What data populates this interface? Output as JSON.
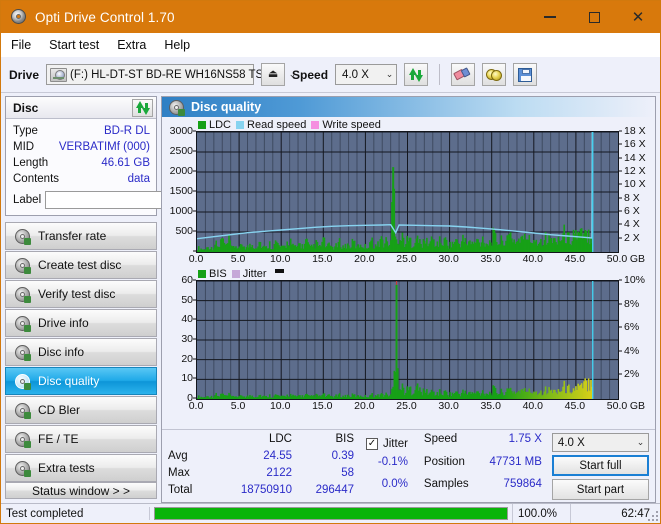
{
  "window": {
    "title": "Opti Drive Control 1.70",
    "icon": "disc-icon",
    "minimize": "—",
    "maximize": "□",
    "close": "✕"
  },
  "menu": {
    "items": [
      "File",
      "Start test",
      "Extra",
      "Help"
    ]
  },
  "toolbar": {
    "drive_label": "Drive",
    "drive_value": "(F:)  HL-DT-ST BD-RE  WH16NS58 TST4",
    "eject_label": "⏏",
    "speed_label": "Speed",
    "speed_value": "4.0 X",
    "chevron": "⌄",
    "icons": [
      "refresh-icon",
      "eraser-icon",
      "two-discs-icon",
      "save-icon"
    ]
  },
  "disc": {
    "header": "Disc",
    "rows": [
      {
        "key": "Type",
        "value": "BD-R DL"
      },
      {
        "key": "MID",
        "value": "VERBATIMf (000)"
      },
      {
        "key": "Length",
        "value": "46.61 GB"
      },
      {
        "key": "Contents",
        "value": "data"
      }
    ],
    "label_key": "Label",
    "label_value": "",
    "label_placeholder": ""
  },
  "sidebar": {
    "items": [
      {
        "label": "Transfer rate",
        "active": false
      },
      {
        "label": "Create test disc",
        "active": false
      },
      {
        "label": "Verify test disc",
        "active": false
      },
      {
        "label": "Drive info",
        "active": false
      },
      {
        "label": "Disc info",
        "active": false
      },
      {
        "label": "Disc quality",
        "active": true
      },
      {
        "label": "CD Bler",
        "active": false
      },
      {
        "label": "FE / TE",
        "active": false
      },
      {
        "label": "Extra tests",
        "active": false
      }
    ],
    "status_window": "Status window > >"
  },
  "panel": {
    "title": "Disc quality",
    "icon": "disc-quality-icon"
  },
  "chart_data": [
    {
      "type": "area",
      "title": "LDC / Read speed",
      "legend": [
        {
          "label": "LDC",
          "color": "#17a017"
        },
        {
          "label": "Read speed",
          "color": "#87d3f0"
        },
        {
          "label": "Write speed",
          "color": "#f58fe0"
        }
      ],
      "legend_position": "top-left",
      "grid": true,
      "xlabel": "GB",
      "xlim": [
        0,
        50
      ],
      "xticks": [
        0.0,
        5.0,
        10.0,
        15.0,
        20.0,
        25.0,
        30.0,
        35.0,
        40.0,
        45.0,
        50.0
      ],
      "xticklabels": [
        "0.0",
        "5.0",
        "10.0",
        "15.0",
        "20.0",
        "25.0",
        "30.0",
        "35.0",
        "40.0",
        "45.0",
        "50.0"
      ],
      "ylabel": "",
      "ylim": [
        0,
        3000
      ],
      "yticks": [
        0,
        500,
        1000,
        1500,
        2000,
        2500,
        3000
      ],
      "yticklabels": [
        "0",
        "500",
        "1000",
        "1500",
        "2000",
        "2500",
        "3000"
      ],
      "y2label": "",
      "y2lim": [
        0,
        18
      ],
      "y2ticks": [
        2,
        4,
        6,
        8,
        10,
        12,
        14,
        16,
        18
      ],
      "y2ticklabels": [
        "2 X",
        "4 X",
        "6 X",
        "8 X",
        "10 X",
        "12 X",
        "14 X",
        "16 X",
        "18 X"
      ],
      "series": [
        {
          "name": "LDC",
          "color": "#17a017",
          "axis": "left",
          "x": [
            0.2,
            0.6,
            1.0,
            1.4,
            1.8,
            2.2,
            2.6,
            3.0,
            3.4,
            3.8,
            4.2,
            4.6,
            5.0,
            5.4,
            5.8,
            6.2,
            6.6,
            7.0,
            7.4,
            7.8,
            8.2,
            8.6,
            9.0,
            9.4,
            9.8,
            10.2,
            10.6,
            11.0,
            11.4,
            11.8,
            12.2,
            12.6,
            13.0,
            13.4,
            13.8,
            14.2,
            14.6,
            15.0,
            15.4,
            15.8,
            16.2,
            16.6,
            17.0,
            17.4,
            17.8,
            18.2,
            18.6,
            19.0,
            19.4,
            19.8,
            20.2,
            20.6,
            21.0,
            21.4,
            21.8,
            22.2,
            22.6,
            23.0,
            23.3,
            23.7,
            24.0,
            24.4,
            24.8,
            25.2,
            25.6,
            26.0,
            26.4,
            26.8,
            27.2,
            27.6,
            28.0,
            28.4,
            28.8,
            29.2,
            29.6,
            30.0,
            30.4,
            30.8,
            31.2,
            31.6,
            32.0,
            32.4,
            32.8,
            33.2,
            33.6,
            34.0,
            34.4,
            34.8,
            35.2,
            35.6,
            36.0,
            36.4,
            36.8,
            37.2,
            37.6,
            38.0,
            38.4,
            38.8,
            39.2,
            39.6,
            40.0,
            40.4,
            40.8,
            41.2,
            41.6,
            42.0,
            42.4,
            42.8,
            43.2,
            43.6,
            44.0,
            44.4,
            44.8,
            45.2,
            45.6,
            46.0,
            46.4,
            46.8
          ],
          "y": [
            120,
            90,
            70,
            180,
            95,
            260,
            120,
            420,
            150,
            330,
            110,
            200,
            90,
            250,
            130,
            180,
            210,
            140,
            330,
            160,
            120,
            250,
            140,
            300,
            160,
            120,
            210,
            390,
            170,
            130,
            260,
            150,
            340,
            120,
            170,
            250,
            140,
            360,
            150,
            200,
            130,
            180,
            290,
            140,
            220,
            160,
            310,
            130,
            240,
            180,
            140,
            380,
            220,
            160,
            420,
            250,
            330,
            180,
            2122,
            520,
            330,
            430,
            290,
            360,
            250,
            400,
            300,
            230,
            340,
            260,
            390,
            220,
            310,
            270,
            350,
            200,
            280,
            320,
            240,
            380,
            260,
            300,
            220,
            340,
            280,
            420,
            250,
            300,
            480,
            360,
            260,
            440,
            300,
            540,
            380,
            290,
            460,
            330,
            520,
            280,
            430,
            360,
            300,
            500,
            340,
            420,
            310,
            470,
            360,
            550,
            420,
            380,
            620,
            480,
            520,
            420,
            600,
            480
          ]
        },
        {
          "name": "Read speed",
          "color": "#87d3f0",
          "axis": "right",
          "x": [
            0.0,
            2.0,
            4.0,
            6.0,
            8.0,
            10.0,
            12.0,
            14.0,
            16.0,
            18.0,
            20.0,
            22.0,
            23.0,
            23.6,
            24.0,
            26.0,
            28.0,
            30.0,
            32.0,
            34.0,
            36.0,
            38.0,
            40.0,
            42.0,
            44.0,
            46.0,
            46.9,
            46.95,
            47.0
          ],
          "y": [
            2.0,
            2.3,
            2.6,
            2.9,
            3.1,
            3.3,
            3.5,
            3.7,
            3.85,
            3.95,
            4.0,
            4.05,
            4.1,
            2.9,
            4.05,
            4.0,
            3.95,
            3.9,
            3.75,
            3.55,
            3.35,
            3.1,
            2.85,
            2.6,
            2.4,
            2.2,
            2.1,
            18.0,
            18.0
          ]
        }
      ],
      "end_marker_x": 47.0,
      "end_marker_color": "#45d0ee"
    },
    {
      "type": "area",
      "title": "BIS / Jitter",
      "legend": [
        {
          "label": "BIS",
          "color": "#17a017"
        },
        {
          "label": "Jitter",
          "color": "#c6a8d8"
        }
      ],
      "legend_position": "top-left",
      "grid": true,
      "xlabel": "GB",
      "xlim": [
        0,
        50
      ],
      "xticks": [
        0.0,
        5.0,
        10.0,
        15.0,
        20.0,
        25.0,
        30.0,
        35.0,
        40.0,
        45.0,
        50.0
      ],
      "xticklabels": [
        "0.0",
        "5.0",
        "10.0",
        "15.0",
        "20.0",
        "25.0",
        "30.0",
        "35.0",
        "40.0",
        "45.0",
        "50.0"
      ],
      "ylim": [
        0,
        60
      ],
      "yticks": [
        0,
        10,
        20,
        30,
        40,
        50,
        60
      ],
      "yticklabels": [
        "0",
        "10",
        "20",
        "30",
        "40",
        "50",
        "60"
      ],
      "y2lim": [
        0,
        10
      ],
      "y2ticks": [
        2,
        4,
        6,
        8,
        10
      ],
      "y2ticklabels": [
        "2%",
        "4%",
        "6%",
        "8%",
        "10%"
      ],
      "series": [
        {
          "name": "BIS",
          "color": "#17a017",
          "axis": "left",
          "x": [
            0.2,
            0.6,
            1.0,
            1.4,
            1.8,
            2.2,
            2.6,
            3.0,
            3.4,
            3.8,
            4.2,
            4.6,
            5.0,
            5.4,
            5.8,
            6.2,
            6.6,
            7.0,
            7.4,
            7.8,
            8.2,
            8.6,
            9.0,
            9.4,
            9.8,
            10.2,
            10.6,
            11.0,
            11.4,
            11.8,
            12.2,
            12.6,
            13.0,
            13.4,
            13.8,
            14.2,
            14.6,
            15.0,
            15.4,
            15.8,
            16.2,
            16.6,
            17.0,
            17.4,
            17.8,
            18.2,
            18.6,
            19.0,
            19.4,
            19.8,
            20.2,
            20.6,
            21.0,
            21.4,
            21.8,
            22.2,
            22.6,
            23.0,
            23.4,
            23.7,
            24.0,
            24.4,
            24.8,
            25.2,
            25.6,
            26.0,
            26.4,
            26.8,
            27.2,
            27.6,
            28.0,
            28.4,
            28.8,
            29.2,
            29.6,
            30.0,
            30.4,
            30.8,
            31.2,
            31.6,
            32.0,
            32.4,
            32.8,
            33.2,
            33.6,
            34.0,
            34.4,
            34.8,
            35.2,
            35.6,
            36.0,
            36.4,
            36.8,
            37.2,
            37.6,
            38.0,
            38.4,
            38.8,
            39.2,
            39.6,
            40.0,
            40.4,
            40.8,
            41.2,
            41.6,
            42.0,
            42.4,
            42.8,
            43.2,
            43.6,
            44.0,
            44.4,
            44.8,
            45.2,
            45.6,
            46.0,
            46.3,
            46.6,
            46.9
          ],
          "y": [
            1.5,
            1.2,
            1.0,
            2.0,
            1.3,
            2.8,
            1.4,
            3.2,
            1.6,
            2.4,
            1.2,
            1.9,
            1.1,
            2.2,
            1.4,
            1.8,
            2.1,
            1.5,
            2.6,
            1.7,
            1.3,
            2.2,
            1.5,
            2.4,
            1.7,
            1.3,
            2.0,
            2.8,
            1.8,
            1.4,
            2.3,
            1.6,
            2.6,
            1.3,
            1.8,
            2.2,
            1.5,
            2.7,
            1.6,
            2.0,
            1.4,
            1.9,
            2.4,
            1.5,
            2.2,
            1.7,
            2.5,
            1.4,
            2.3,
            1.8,
            1.5,
            2.8,
            2.2,
            1.7,
            3.0,
            2.4,
            2.8,
            2.0,
            9.5,
            58,
            5.5,
            7.0,
            4.5,
            6.0,
            5.0,
            8.0,
            5.5,
            4.0,
            5.0,
            3.5,
            4.5,
            3.0,
            4.0,
            3.2,
            4.2,
            2.8,
            3.5,
            3.8,
            3.0,
            4.2,
            3.4,
            3.8,
            3.0,
            4.0,
            3.6,
            4.8,
            3.4,
            3.8,
            5.5,
            4.4,
            3.6,
            5.0,
            4.0,
            6.2,
            4.6,
            3.8,
            5.6,
            4.2,
            6.0,
            3.8,
            5.4,
            4.6,
            4.0,
            6.4,
            4.4,
            5.6,
            4.2,
            6.2,
            4.8,
            7.4,
            5.6,
            6.6,
            5.4,
            7.8,
            6.2,
            8.6,
            9.5,
            11.0,
            13.5
          ]
        },
        {
          "name": "Jitter",
          "color": "#c6a8d8",
          "axis": "right",
          "x": [],
          "y": []
        }
      ],
      "spike_marker": {
        "x": 23.7,
        "color": "#c43a3a",
        "note": "red spike marker"
      },
      "end_marker_x": 47.0,
      "end_marker_color": "#45d0ee"
    }
  ],
  "stats": {
    "columns": [
      "LDC",
      "BIS"
    ],
    "rows": [
      {
        "label": "Avg",
        "ldc": "24.55",
        "bis": "0.39"
      },
      {
        "label": "Max",
        "ldc": "2122",
        "bis": "58"
      },
      {
        "label": "Total",
        "ldc": "18750910",
        "bis": "296447"
      }
    ],
    "jitter": {
      "label": "Jitter",
      "checked": true,
      "check_glyph": "✓",
      "avg": "-0.1%",
      "max": "0.0%"
    },
    "speed_label": "Speed",
    "speed_value": "1.75 X",
    "position_label": "Position",
    "position_value": "47731 MB",
    "samples_label": "Samples",
    "samples_value": "759864",
    "speed_select": "4.0 X",
    "chevron": "⌄",
    "start_full": "Start full",
    "start_part": "Start part"
  },
  "statusbar": {
    "message": "Test completed",
    "progress_percent": "100.0%",
    "progress_value": 100,
    "elapsed": "62:47",
    "bar_color": "#09b409"
  }
}
